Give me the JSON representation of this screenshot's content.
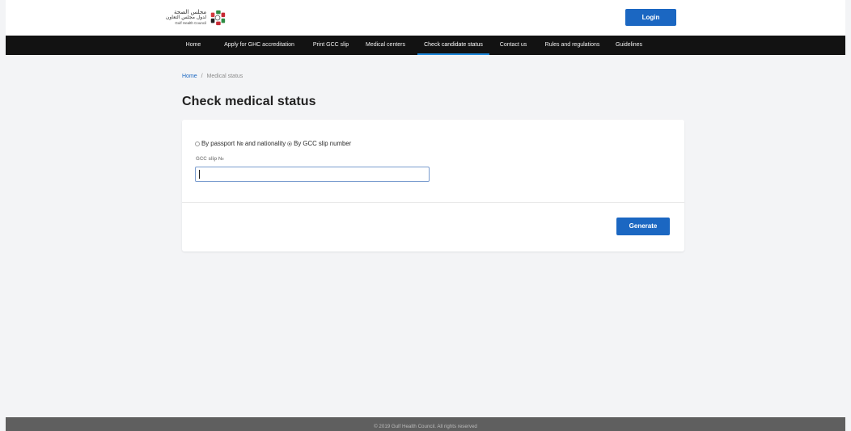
{
  "header": {
    "logo": {
      "arabic_line_1": "مجلس الصحة",
      "arabic_line_2": "لدول مجلس التعاون",
      "english": "Gulf Health Council"
    },
    "login_label": "Login"
  },
  "nav": {
    "items": [
      {
        "label": "Home"
      },
      {
        "label": "Apply for GHC accreditation"
      },
      {
        "label": "Print GCC slip"
      },
      {
        "label": "Medical centers"
      },
      {
        "label": "Check candidate status",
        "active": true
      },
      {
        "label": "Contact us"
      },
      {
        "label": "Rules and regulations"
      },
      {
        "label": "Guidelines"
      }
    ]
  },
  "breadcrumb": {
    "home": "Home",
    "separator": "/",
    "current": "Medical status"
  },
  "main": {
    "title": "Check medical status",
    "options": [
      {
        "label": "By passport № and nationality",
        "selected": false
      },
      {
        "label": "By GCC slip number",
        "selected": true
      }
    ],
    "gcc_slip_label": "GCC slip №",
    "gcc_slip_value": "",
    "gcc_slip_placeholder": "",
    "generate_label": "Generate"
  },
  "footer": {
    "text": "© 2019 Gulf Health Council. All rights reserved"
  },
  "colors": {
    "primary_blue": "#1b67c2",
    "navbar": "#121212",
    "active_tab": "#1d86d8",
    "page_background": "#f3f4f6",
    "footer": "#5f5f5f"
  },
  "icons": {
    "logo": "gulf-health-council-logo-icon",
    "radio": "radio-button-icon"
  }
}
